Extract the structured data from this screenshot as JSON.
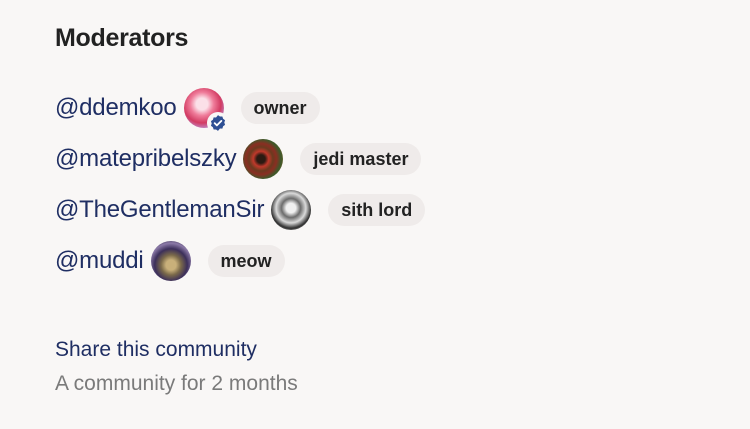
{
  "moderators_section": {
    "title": "Moderators",
    "moderators": [
      {
        "handle": "@ddemkoo",
        "role": "owner",
        "verified": true
      },
      {
        "handle": "@matepribelszky",
        "role": "jedi master",
        "verified": false
      },
      {
        "handle": "@TheGentlemanSir",
        "role": "sith lord",
        "verified": false
      },
      {
        "handle": "@muddi",
        "role": "meow",
        "verified": false
      }
    ]
  },
  "footer": {
    "share_label": "Share this community",
    "age_text": "A community for 2 months"
  },
  "icons": {
    "verified": "verified-check-icon"
  },
  "colors": {
    "background": "#f9f7f6",
    "link": "#1f2e63",
    "badge_bg": "#efebea",
    "verified": "#2f4f93",
    "muted_text": "#7a7a7a"
  }
}
